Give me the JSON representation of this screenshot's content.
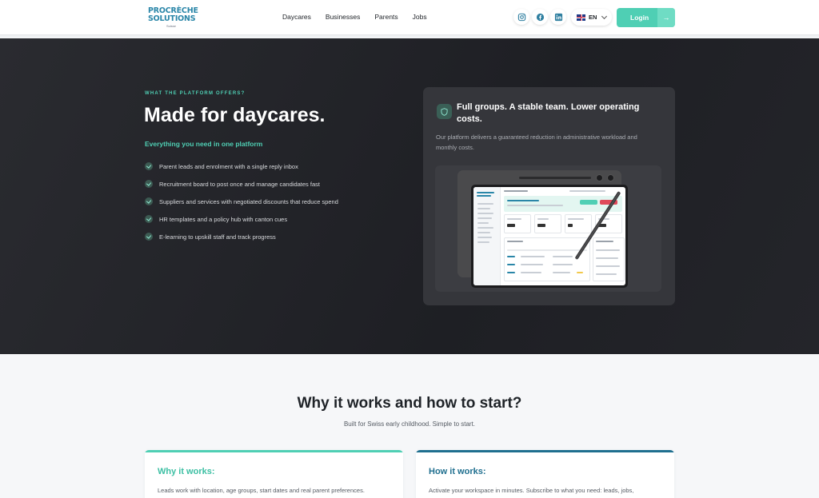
{
  "brand": {
    "line1_a": "PROCRÈCHE",
    "line2": "SOLUTIONS",
    "sub": "Suisse",
    "primary_color": "#2a86a8",
    "accent_color": "#e0495a"
  },
  "nav": {
    "items": [
      {
        "label": "Daycares"
      },
      {
        "label": "Businesses"
      },
      {
        "label": "Parents"
      },
      {
        "label": "Jobs"
      }
    ]
  },
  "social": {
    "icons": [
      "instagram-icon",
      "facebook-icon",
      "linkedin-icon"
    ]
  },
  "language": {
    "code": "EN",
    "flag": "uk-flag-icon"
  },
  "login": {
    "label": "Login",
    "arrow": "→",
    "color": "#4fcfb4"
  },
  "hero": {
    "eyebrow": "WHAT THE PLATFORM OFFERS?",
    "title": "Made for daycares.",
    "subtitle": "Everything you need in one platform",
    "features": [
      "Parent leads and enrolment with a single reply inbox",
      "Recruitment board to post once and manage candidates fast",
      "Suppliers and services with negotiated discounts that reduce spend",
      "HR templates and a policy hub with canton cues",
      "E-learning to upskill staff and track progress"
    ],
    "card": {
      "icon": "shield-icon",
      "title": "Full groups. A stable team. Lower operating costs.",
      "text": "Our platform delivers a guaranteed reduction in administrative workload and monthly costs."
    }
  },
  "section": {
    "title": "Why it works and how to start?",
    "subtitle": "Built for Swiss early childhood. Simple to start.",
    "cards": [
      {
        "title": "Why it works:",
        "text": "Leads work with location, age groups, start dates and real parent preferences.",
        "color": "#4fcfb4"
      },
      {
        "title": "How it works:",
        "text": "Activate your workspace in minutes. Subscribe to what you need: leads, jobs,",
        "color": "#1f6f8f"
      }
    ]
  }
}
